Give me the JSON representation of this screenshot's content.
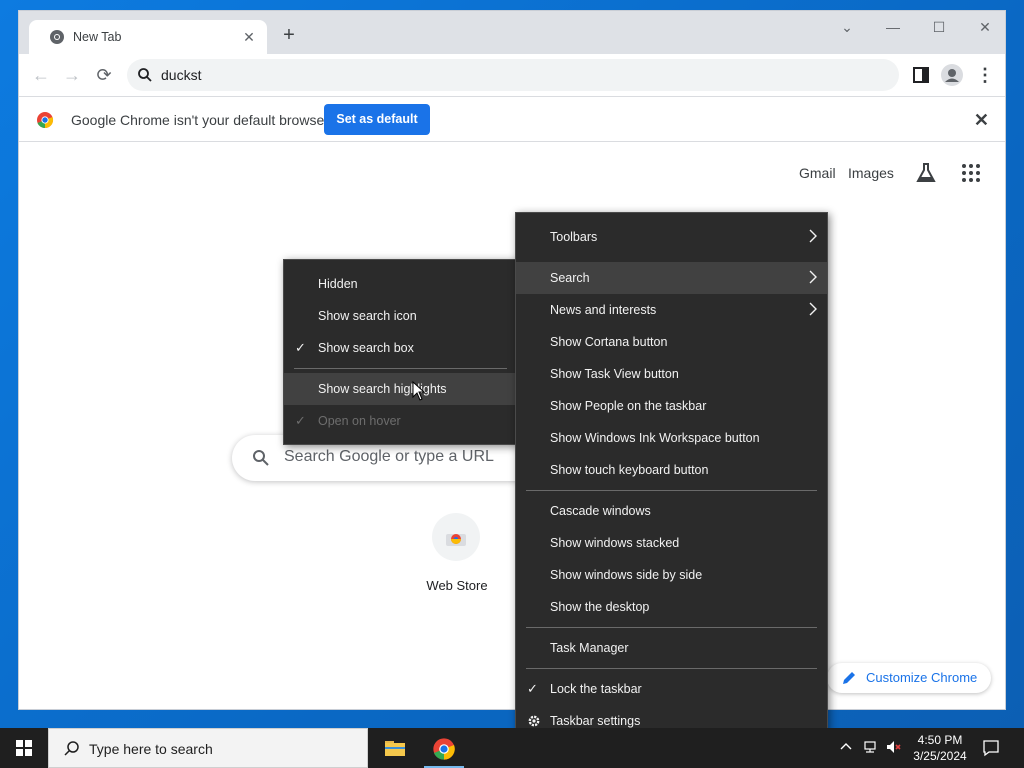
{
  "browser": {
    "tab_title": "New Tab",
    "new_tab": "+",
    "tab_close": "✕",
    "address": "duckst",
    "infobar_text": "Google Chrome isn't your default browser",
    "infobar_button": "Set as default",
    "infobar_close": "✕"
  },
  "ntp": {
    "links": [
      "Gmail",
      "Images"
    ],
    "search_placeholder": "Search Google or type a URL",
    "shortcut_label": "Web Store",
    "customize_label": "Customize Chrome"
  },
  "context_menu": {
    "items": [
      {
        "label": "Toolbars",
        "submenu": true
      },
      {
        "label": "Search",
        "submenu": true,
        "highlighted": true
      },
      {
        "label": "News and interests",
        "submenu": true
      },
      {
        "label": "Show Cortana button"
      },
      {
        "label": "Show Task View button"
      },
      {
        "label": "Show People on the taskbar"
      },
      {
        "label": "Show Windows Ink Workspace button"
      },
      {
        "label": "Show touch keyboard button"
      },
      {
        "label": "Cascade windows"
      },
      {
        "label": "Show windows stacked"
      },
      {
        "label": "Show windows side by side"
      },
      {
        "label": "Show the desktop"
      },
      {
        "label": "Task Manager"
      },
      {
        "label": "Lock the taskbar",
        "checked": true
      },
      {
        "label": "Taskbar settings",
        "icon": "gear-icon"
      }
    ]
  },
  "search_submenu": {
    "items": [
      {
        "label": "Hidden"
      },
      {
        "label": "Show search icon"
      },
      {
        "label": "Show search box",
        "checked": true
      },
      {
        "label": "Show search highlights",
        "highlighted": true
      },
      {
        "label": "Open on hover",
        "checked": true,
        "disabled": true
      }
    ]
  },
  "taskbar": {
    "search_placeholder": "Type here to search",
    "time": "4:50 PM",
    "date": "3/25/2024"
  },
  "colors": {
    "accent": "#1a73e8",
    "desktop": "#0a6fd1",
    "menu_bg": "#2b2b2b"
  }
}
